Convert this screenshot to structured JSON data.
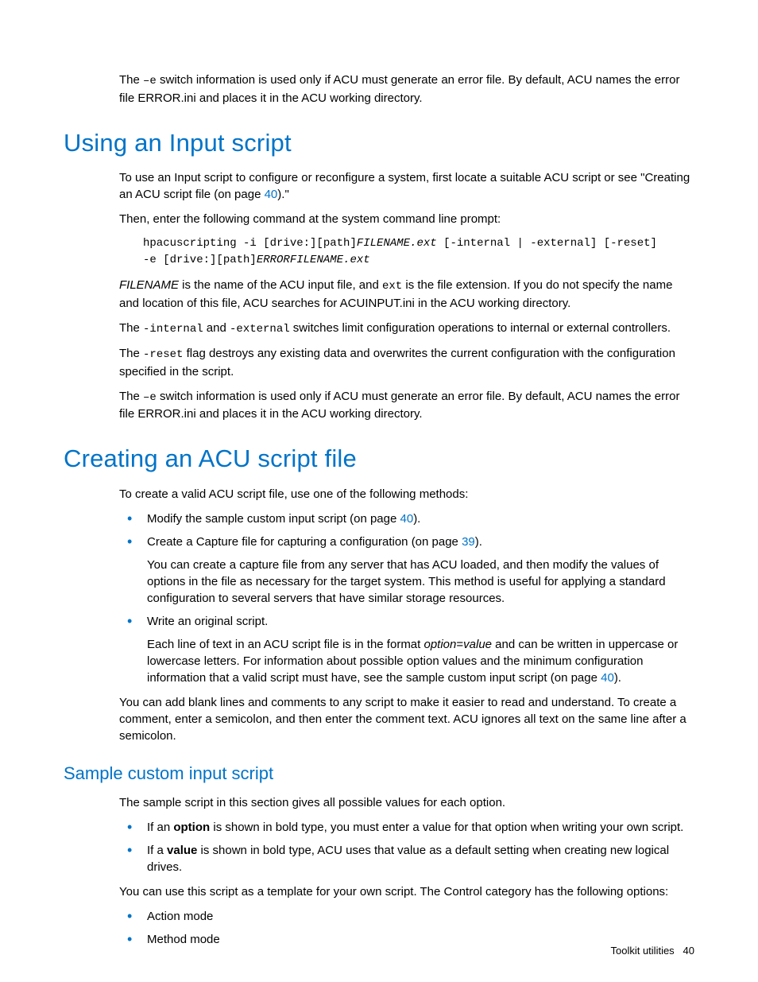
{
  "intro_para": {
    "t1": "The ",
    "code1": "–e",
    "t2": " switch information is used only if ACU must generate an error file. By default, ACU names the error file ERROR.ini and places it in the ACU working directory."
  },
  "h1_input": "Using an Input script",
  "input": {
    "p1a": "To use an Input script to configure or reconfigure a system, first locate a suitable ACU script or see \"Creating an ACU script file (on page ",
    "p1_link": "40",
    "p1b": ").\"",
    "p2": "Then, enter the following command at the system command line prompt:",
    "code_l1a": "hpacuscripting -i [drive:][path]",
    "code_l1b": "FILENAME.ext",
    "code_l1c": " [-internal | -external] [-reset]",
    "code_l2a": "-e [drive:][path]",
    "code_l2b": "ERRORFILENAME.ext",
    "p3a": "FILENAME",
    "p3b": " is the name of the ACU input file, and ",
    "p3c": "ext",
    "p3d": " is the file extension. If you do not specify the name and location of this file, ACU searches for ACUINPUT.ini in the ACU working directory.",
    "p4a": "The ",
    "p4b": "-internal",
    "p4c": " and ",
    "p4d": "-external",
    "p4e": " switches limit configuration operations to internal or external controllers.",
    "p5a": "The ",
    "p5b": "-reset",
    "p5c": " flag destroys any existing data and overwrites the current configuration with the configuration specified in the script.",
    "p6a": "The ",
    "p6b": "–e",
    "p6c": " switch information is used only if ACU must generate an error file. By default, ACU names the error file ERROR.ini and places it in the ACU working directory."
  },
  "h1_create": "Creating an ACU script file",
  "create": {
    "p1": "To create a valid ACU script file, use one of the following methods:",
    "li1a": "Modify the sample custom input script (on page ",
    "li1_link": "40",
    "li1b": ").",
    "li2a": "Create a Capture file for capturing a configuration (on page ",
    "li2_link": "39",
    "li2b": ").",
    "li2_sub": "You can create a capture file from any server that has ACU loaded, and then modify the values of options in the file as necessary for the target system. This method is useful for applying a standard configuration to several servers that have similar storage resources.",
    "li3": "Write an original script.",
    "li3_sub_a": "Each line of text in an ACU script file is in the format ",
    "li3_sub_b": "option",
    "li3_sub_c": "=",
    "li3_sub_d": "value",
    "li3_sub_e": " and can be written in uppercase or lowercase letters. For information about possible option values and the minimum configuration information that a valid script must have, see the sample custom input script (on page ",
    "li3_sub_link": "40",
    "li3_sub_f": ").",
    "p2": "You can add blank lines and comments to any script to make it easier to read and understand. To create a comment, enter a semicolon, and then enter the comment text. ACU ignores all text on the same line after a semicolon."
  },
  "h2_sample": "Sample custom input script",
  "sample": {
    "p1": "The sample script in this section gives all possible values for each option.",
    "li1a": "If an ",
    "li1b": "option",
    "li1c": " is shown in bold type, you must enter a value for that option when writing your own script.",
    "li2a": "If a ",
    "li2b": "value",
    "li2c": " is shown in bold type, ACU uses that value as a default setting when creating new logical drives.",
    "p2": "You can use this script as a template for your own script. The Control category has the following options:",
    "li3": "Action mode",
    "li4": "Method mode"
  },
  "footer": {
    "label": "Toolkit utilities",
    "page": "40"
  }
}
